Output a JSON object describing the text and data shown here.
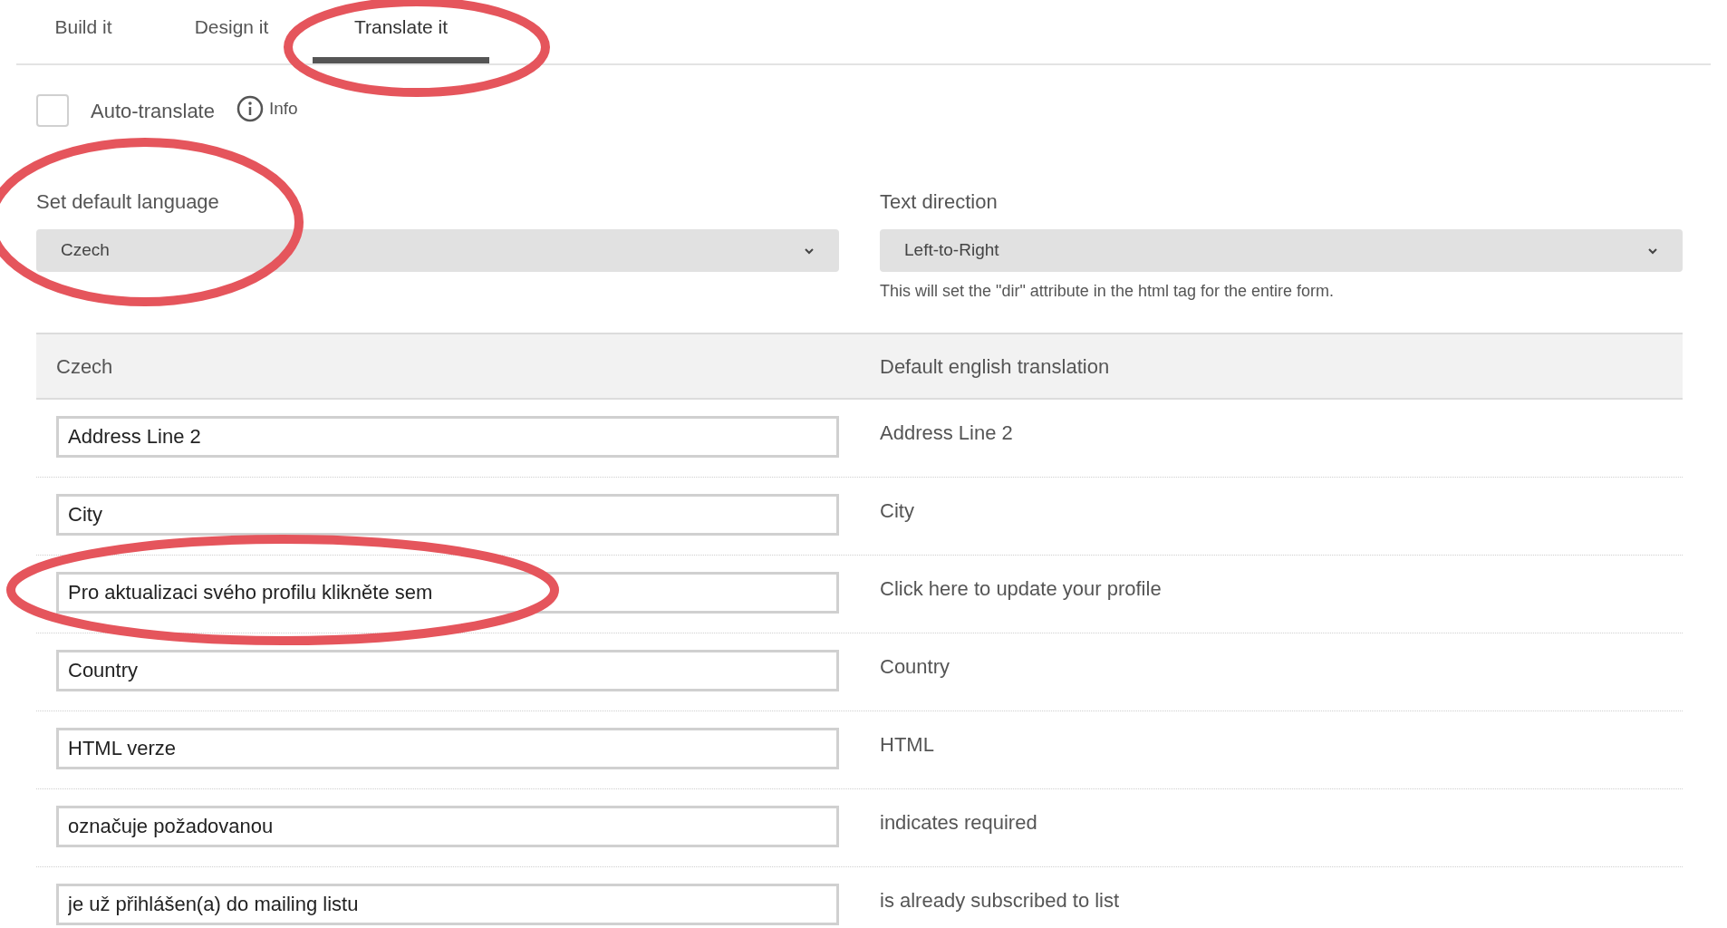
{
  "tabs": [
    {
      "label": "Build it",
      "selected": false
    },
    {
      "label": "Design it",
      "selected": false
    },
    {
      "label": "Translate it",
      "selected": true
    }
  ],
  "auto_translate": {
    "label": "Auto-translate",
    "checked": false,
    "info": "Info"
  },
  "default_language": {
    "label": "Set default language",
    "value": "Czech"
  },
  "text_direction": {
    "label": "Text direction",
    "value": "Left-to-Right",
    "help": "This will set the \"dir\" attribute in the html tag for the entire form."
  },
  "table": {
    "columns": [
      "Czech",
      "Default english translation"
    ],
    "rows": [
      {
        "translation": "Address Line 2",
        "english": "Address Line 2"
      },
      {
        "translation": "City",
        "english": "City"
      },
      {
        "translation": "Pro aktualizaci svého profilu klikněte sem",
        "english": "Click here to update your profile"
      },
      {
        "translation": "Country",
        "english": "Country"
      },
      {
        "translation": "HTML verze",
        "english": "HTML"
      },
      {
        "translation": "označuje požadovanou",
        "english": "indicates required"
      },
      {
        "translation": "je už přihlášen(a) do mailing listu",
        "english": "is already subscribed to list"
      }
    ]
  }
}
